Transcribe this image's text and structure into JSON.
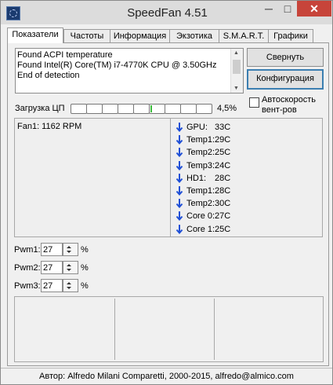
{
  "window": {
    "title": "SpeedFan 4.51",
    "minimize": "─",
    "maximize": "□",
    "close": "✕"
  },
  "tabs": [
    {
      "label": "Показатели",
      "active": true
    },
    {
      "label": "Частоты"
    },
    {
      "label": "Информация"
    },
    {
      "label": "Экзотика"
    },
    {
      "label": "S.M.A.R.T."
    },
    {
      "label": "Графики"
    }
  ],
  "log": {
    "lines": [
      "Found ACPI temperature",
      "Found Intel(R) Core(TM) i7-4770K CPU @ 3.50GHz",
      "End of detection"
    ]
  },
  "buttons": {
    "minimize_label": "Свернуть",
    "config_label": "Конфигурация"
  },
  "autospeed": {
    "label_line1": "Автоскорость",
    "label_line2": "вент-ров",
    "checked": false
  },
  "cpu": {
    "label": "Загрузка ЦП",
    "value": "4,5%",
    "bars": 9,
    "level": 0.045
  },
  "fans": [
    "Fan1: 1162 RPM"
  ],
  "temps": [
    {
      "name": "GPU:",
      "value": "33C"
    },
    {
      "name": "Temp1:",
      "value": "29C"
    },
    {
      "name": "Temp2:",
      "value": "25C"
    },
    {
      "name": "Temp3:",
      "value": "24C"
    },
    {
      "name": "HD1:",
      "value": "28C"
    },
    {
      "name": "Temp1:",
      "value": "28C"
    },
    {
      "name": "Temp2:",
      "value": "30C"
    },
    {
      "name": "Core 0:",
      "value": "27C"
    },
    {
      "name": "Core 1:",
      "value": "25C"
    }
  ],
  "temp_icon": "arrow-down-icon",
  "temp_icon_color": "#1f4fd6",
  "pwm": [
    {
      "label": "Pwm1:",
      "value": "27",
      "unit": "%"
    },
    {
      "label": "Pwm2:",
      "value": "27",
      "unit": "%"
    },
    {
      "label": "Pwm3:",
      "value": "27",
      "unit": "%"
    }
  ],
  "status": "Автор: Alfredo Milani Comparetti, 2000-2015, alfredo@almico.com"
}
